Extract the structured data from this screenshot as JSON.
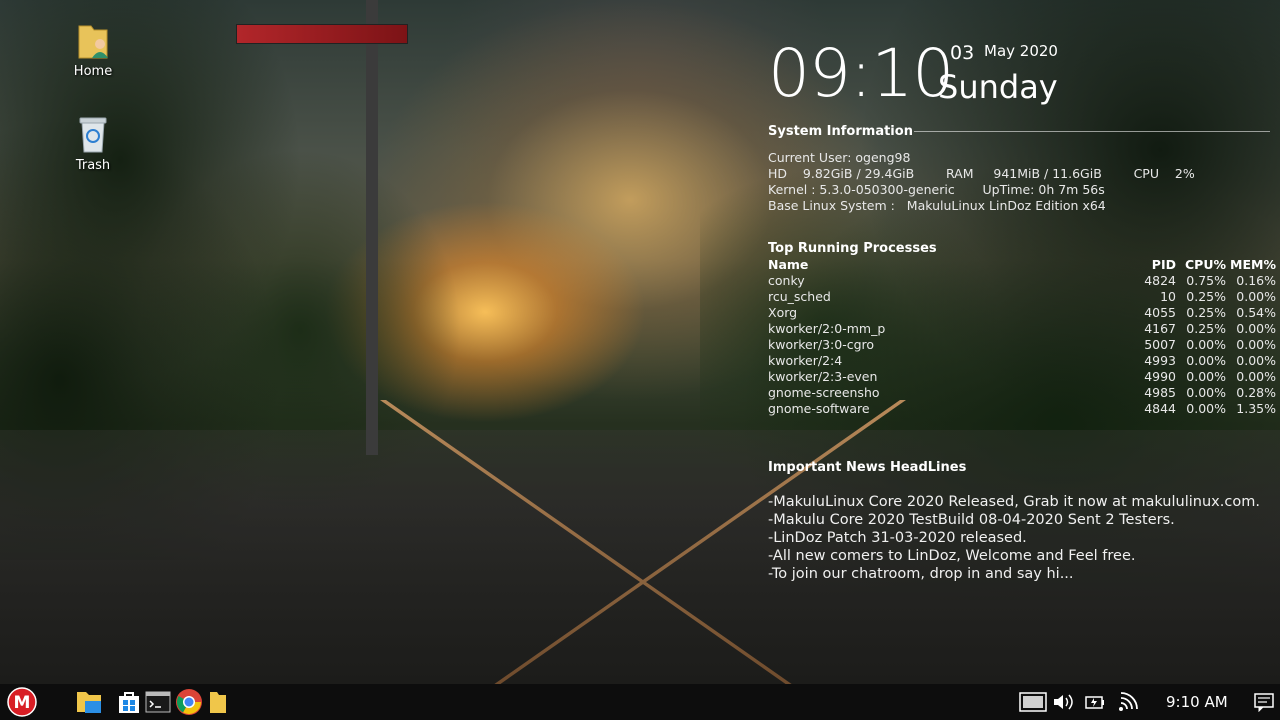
{
  "desktop": {
    "icons": [
      {
        "label": "Home",
        "icon": "home-folder-icon"
      },
      {
        "label": "Trash",
        "icon": "trash-icon"
      }
    ]
  },
  "conky": {
    "clock": {
      "time": "09:10",
      "day": "03",
      "month_year": "May 2020",
      "weekday": "Sunday"
    },
    "system_info": {
      "title": "System Information",
      "current_user": "Current User: ogeng98",
      "resources": "HD    9.82GiB / 29.4GiB        RAM     941MiB / 11.6GiB        CPU    2%",
      "kernel": "Kernel : 5.3.0-050300-generic       UpTime: 0h 7m 56s",
      "base_system": "Base Linux System :   MakuluLinux LinDoz Edition x64"
    },
    "processes": {
      "title": "Top Running Processes",
      "headers": {
        "name": "Name",
        "pid": "PID",
        "cpu": "CPU%",
        "mem": "MEM%"
      },
      "rows": [
        {
          "name": "conky",
          "pid": "4824",
          "cpu": "0.75%",
          "mem": "0.16%"
        },
        {
          "name": "rcu_sched",
          "pid": "10",
          "cpu": "0.25%",
          "mem": "0.00%"
        },
        {
          "name": "Xorg",
          "pid": "4055",
          "cpu": "0.25%",
          "mem": "0.54%"
        },
        {
          "name": "kworker/2:0-mm_p",
          "pid": "4167",
          "cpu": "0.25%",
          "mem": "0.00%"
        },
        {
          "name": "kworker/3:0-cgro",
          "pid": "5007",
          "cpu": "0.00%",
          "mem": "0.00%"
        },
        {
          "name": "kworker/2:4",
          "pid": "4993",
          "cpu": "0.00%",
          "mem": "0.00%"
        },
        {
          "name": "kworker/2:3-even",
          "pid": "4990",
          "cpu": "0.00%",
          "mem": "0.00%"
        },
        {
          "name": "gnome-screensho",
          "pid": "4985",
          "cpu": "0.00%",
          "mem": "0.28%"
        },
        {
          "name": "gnome-software",
          "pid": "4844",
          "cpu": "0.00%",
          "mem": "1.35%"
        }
      ]
    },
    "news": {
      "title": "Important News HeadLines",
      "items": [
        "-MakuluLinux Core 2020 Released, Grab it now at makululinux.com.",
        "-Makulu Core 2020 TestBuild 08-04-2020 Sent 2 Testers.",
        "-LinDoz Patch 31-03-2020 released.",
        "-All new comers to LinDoz, Welcome and Feel free.",
        "-To join our chatroom, drop in and say hi..."
      ]
    }
  },
  "taskbar": {
    "start_label": "M",
    "pinned": [
      {
        "name": "file-manager-icon"
      },
      {
        "name": "windows-store-icon"
      },
      {
        "name": "terminal-icon"
      },
      {
        "name": "chrome-icon"
      },
      {
        "name": "folder-icon"
      }
    ],
    "tray": [
      {
        "name": "network-display-icon"
      },
      {
        "name": "volume-icon"
      },
      {
        "name": "battery-icon"
      },
      {
        "name": "wifi-icon"
      }
    ],
    "clock": "9:10 AM",
    "colors": {
      "start": "#d81e25",
      "bar": "#0d0d0d"
    }
  }
}
